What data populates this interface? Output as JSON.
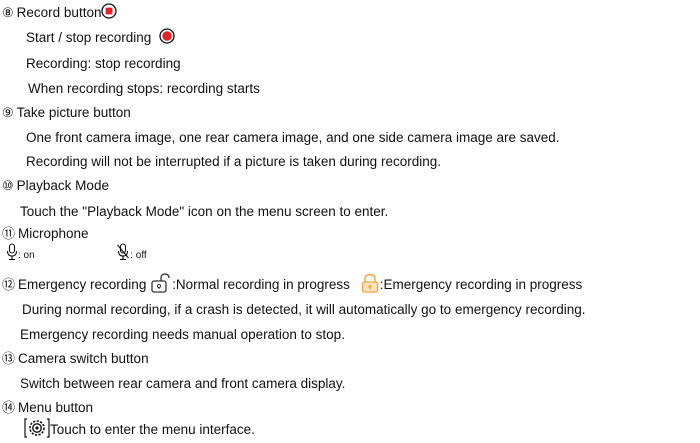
{
  "s8": {
    "num": "⑧",
    "title": "Record button",
    "line1": "Start / stop recording",
    "line2": "Recording: stop recording",
    "line3": "When recording stops: recording starts",
    "record_stop_icon": "record-stop-icon",
    "record_dot_icon": "record-dot-icon"
  },
  "s9": {
    "num": "⑨",
    "title": "Take picture button",
    "line1": "One front camera image, one rear camera image, and one side camera image are saved.",
    "line2": "Recording will not be interrupted if a picture is taken during recording."
  },
  "s10": {
    "num": "⑩",
    "title": "Playback Mode",
    "line1": "Touch the \"Playback Mode\" icon on the menu screen to enter."
  },
  "s11": {
    "num": "⑪",
    "title": "Microphone",
    "on_label": ": on",
    "off_label": ": off",
    "mic_on_icon": "microphone-icon",
    "mic_off_icon": "microphone-off-icon"
  },
  "s12": {
    "num": "⑫",
    "title": "Emergency recording",
    "normal_label": ":Normal recording in progress",
    "emergency_label": ":Emergency recording in progress",
    "line1": "During normal recording, if a crash is detected, it will automatically go to emergency recording.",
    "line2": "Emergency recording needs manual operation to stop.",
    "unlocked_color": "#333333",
    "locked_color": "#f4a43a"
  },
  "s13": {
    "num": "⑬",
    "title": "Camera switch button",
    "line1": "Switch between rear camera and front camera display."
  },
  "s14": {
    "num": "⑭",
    "title": "Menu button",
    "line1": "Touch to enter the menu interface.",
    "menu_icon": "gear-icon"
  },
  "colors": {
    "record_red": "#e8202a"
  }
}
